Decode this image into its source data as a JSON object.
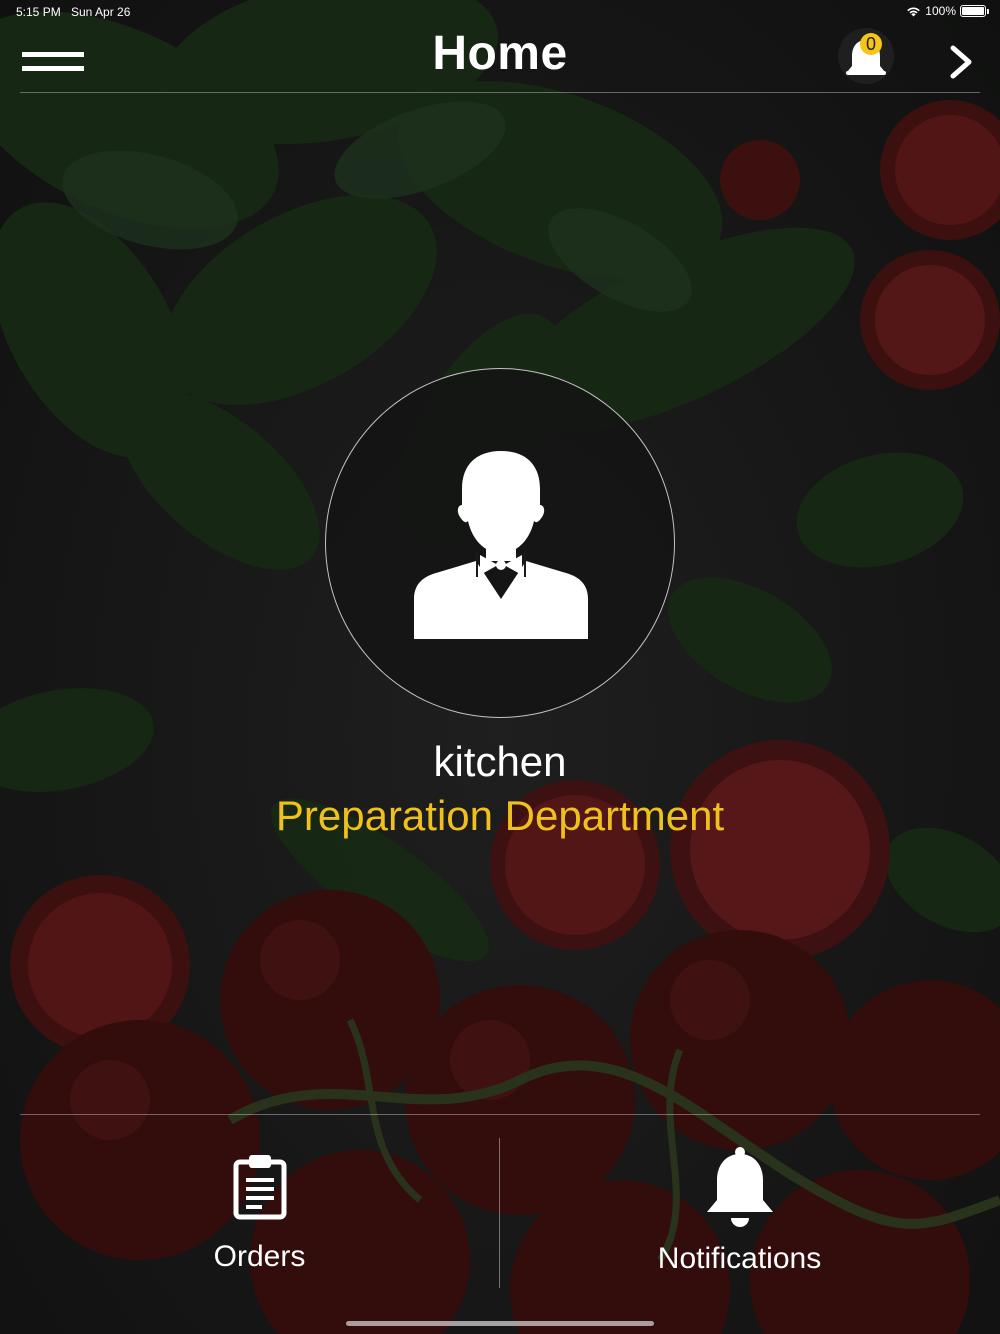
{
  "status_bar": {
    "time": "5:15 PM",
    "date": "Sun Apr 26",
    "battery": "100%"
  },
  "nav": {
    "title": "Home",
    "menu_icon": "hamburger-menu-icon",
    "notification_icon": "bell-icon",
    "notification_count": "0",
    "forward_icon": "chevron-right-icon"
  },
  "profile": {
    "avatar_icon": "waiter-avatar-icon",
    "name": "kitchen",
    "department": "Preparation Department"
  },
  "bottom_tabs": [
    {
      "label": "Orders",
      "icon": "clipboard-icon"
    },
    {
      "label": "Notifications",
      "icon": "bell-icon"
    }
  ],
  "colors": {
    "accent": "#f0c01c",
    "badge": "#f5c518",
    "background": "#1d1f1e",
    "text": "#ffffff"
  }
}
